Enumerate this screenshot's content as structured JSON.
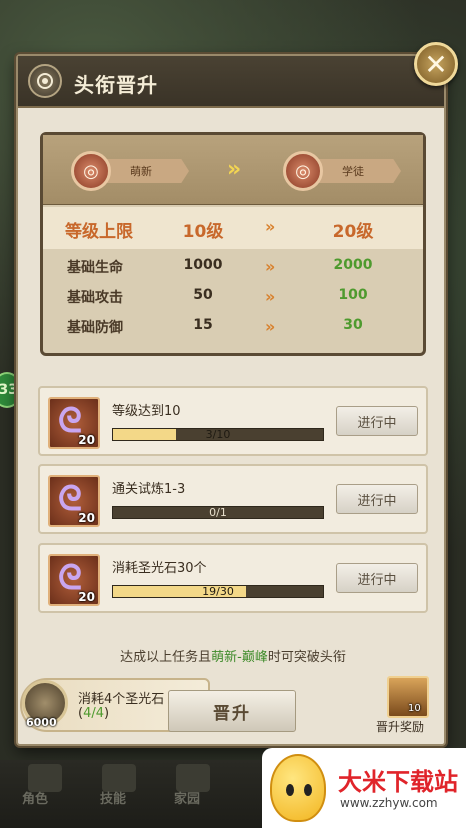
{
  "header": {
    "title": "头衔晋升"
  },
  "rank": {
    "from": "萌新",
    "to": "学徒"
  },
  "stats": {
    "head": {
      "label": "等级上限",
      "from": "10级",
      "to": "20级"
    },
    "rows": [
      {
        "label": "基础生命",
        "from": "1000",
        "to": "2000"
      },
      {
        "label": "基础攻击",
        "from": "50",
        "to": "100"
      },
      {
        "label": "基础防御",
        "from": "15",
        "to": "30"
      }
    ]
  },
  "tasks": [
    {
      "title": "等级达到10",
      "progress": "3/10",
      "fraction": 0.3,
      "icon_count": "20",
      "button": "进行中"
    },
    {
      "title": "通关试炼1-3",
      "progress": "0/1",
      "fraction": 0.0,
      "icon_count": "20",
      "button": "进行中"
    },
    {
      "title": "消耗圣光石30个",
      "progress": "19/30",
      "fraction": 0.633,
      "icon_count": "20",
      "button": "进行中"
    }
  ],
  "footnote": {
    "prefix": "达成以上任务且",
    "highlight": "萌新-巅峰",
    "suffix": "时可突破头衔"
  },
  "cost": {
    "coin_count": "6000",
    "text": "消耗4个圣光石",
    "progress_prefix": "(",
    "progress_value": "4/4",
    "progress_suffix": ")"
  },
  "upgrade_button": "晋升",
  "reward": {
    "count": "10",
    "label": "晋升奖励"
  },
  "nav": [
    "角色",
    "技能",
    "家园"
  ],
  "watermark": {
    "title": "大米下载站",
    "url": "www.zzhyw.com"
  },
  "side_badge": "33",
  "arrow_glyph": "»",
  "close_glyph": "✕",
  "colors": {
    "stat_highlight": "#c8682b",
    "stat_new": "#4e9a2e",
    "bar_fill": "#f3d888"
  }
}
